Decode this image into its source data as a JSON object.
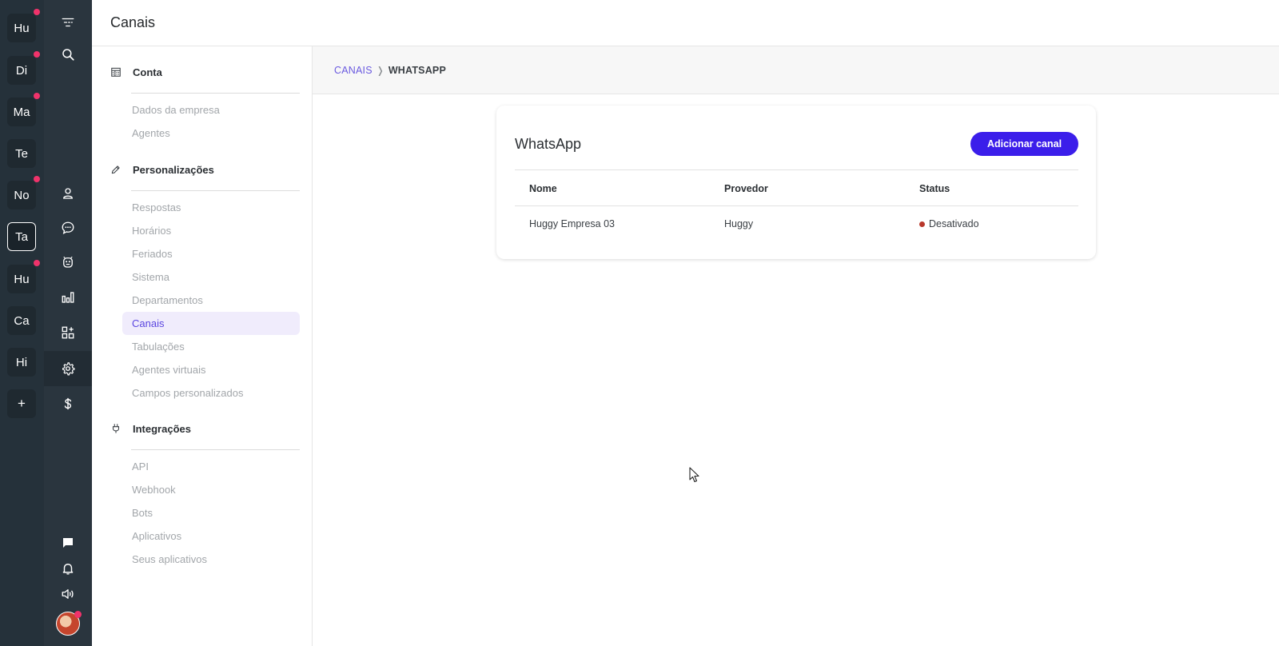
{
  "header": {
    "title": "Canais"
  },
  "workspaces": [
    {
      "label": "Hu",
      "dot": true,
      "active": false
    },
    {
      "label": "Di",
      "dot": true,
      "active": false
    },
    {
      "label": "Ma",
      "dot": true,
      "active": false
    },
    {
      "label": "Te",
      "dot": false,
      "active": false
    },
    {
      "label": "No",
      "dot": true,
      "active": false
    },
    {
      "label": "Ta",
      "dot": false,
      "active": true
    },
    {
      "label": "Hu",
      "dot": true,
      "active": false
    },
    {
      "label": "Ca",
      "dot": false,
      "active": false
    },
    {
      "label": "Hi",
      "dot": false,
      "active": false
    }
  ],
  "workspace_add_label": "+",
  "icon_nav": [
    "menu-icon",
    "search-icon",
    "contacts-icon",
    "chat-bubble-icon",
    "bot-icon",
    "reports-icon",
    "apps-icon",
    "gear-icon",
    "dollar-icon",
    "message-icon",
    "bell-icon",
    "volume-icon"
  ],
  "sidebar": {
    "groups": [
      {
        "title": "Conta",
        "icon": "building-icon",
        "items": [
          "Dados da empresa",
          "Agentes"
        ]
      },
      {
        "title": "Personalizações",
        "icon": "pencil-icon",
        "items": [
          "Respostas",
          "Horários",
          "Feriados",
          "Sistema",
          "Departamentos",
          "Canais",
          "Tabulações",
          "Agentes virtuais",
          "Campos personalizados"
        ]
      },
      {
        "title": "Integrações",
        "icon": "plug-icon",
        "items": [
          "API",
          "Webhook",
          "Bots",
          "Aplicativos",
          "Seus aplicativos"
        ]
      }
    ],
    "active_item": "Canais"
  },
  "breadcrumb": {
    "parent": "CANAIS",
    "separator": "❭",
    "current": "WHATSAPP"
  },
  "card": {
    "title": "WhatsApp",
    "add_button": "Adicionar canal",
    "columns": [
      "Nome",
      "Provedor",
      "Status"
    ],
    "rows": [
      {
        "nome": "Huggy Empresa 03",
        "provedor": "Huggy",
        "status": "Desativado",
        "status_color": "#b8382b"
      }
    ]
  },
  "colors": {
    "accent": "#3b1eea",
    "link": "#6a5ae0",
    "rail": "#25313a",
    "notification": "#f0336b"
  }
}
